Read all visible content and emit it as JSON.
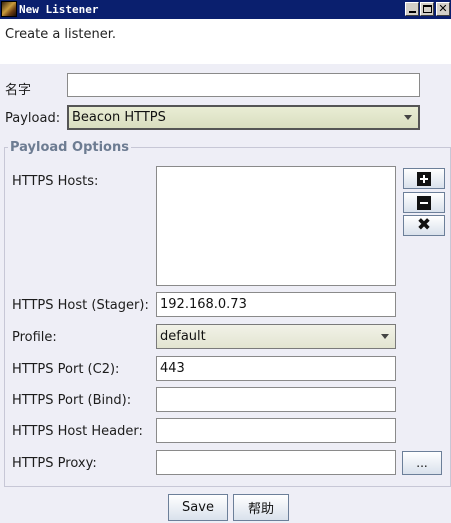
{
  "window": {
    "title": "New Listener",
    "controls": [
      "minimize-icon",
      "maximize-icon",
      "close-icon"
    ]
  },
  "banner": {
    "description": "Create a listener."
  },
  "form": {
    "name_label": "名字",
    "name_value": "",
    "payload_label": "Payload:",
    "payload_value": "Beacon HTTPS"
  },
  "payload_options": {
    "title": "Payload Options",
    "hosts_label": "HTTPS Hosts:",
    "hosts": [],
    "host_buttons": [
      "add-icon",
      "remove-icon",
      "clear-icon"
    ],
    "stager_label": "HTTPS Host (Stager):",
    "stager_value": "192.168.0.73",
    "profile_label": "Profile:",
    "profile_value": "default",
    "port_c2_label": "HTTPS Port (C2):",
    "port_c2_value": "443",
    "port_bind_label": "HTTPS Port (Bind):",
    "port_bind_value": "",
    "host_header_label": "HTTPS Host Header:",
    "host_header_value": "",
    "proxy_label": "HTTPS Proxy:",
    "proxy_value": "",
    "proxy_button_label": "..."
  },
  "actions": {
    "save_label": "Save",
    "help_label": "帮助"
  },
  "colors": {
    "titlebar": "#0a1f6e",
    "window_bg": "#eeeef6",
    "group_title": "#6d7c92",
    "payload_combo_bg": "#e2e6cc"
  }
}
